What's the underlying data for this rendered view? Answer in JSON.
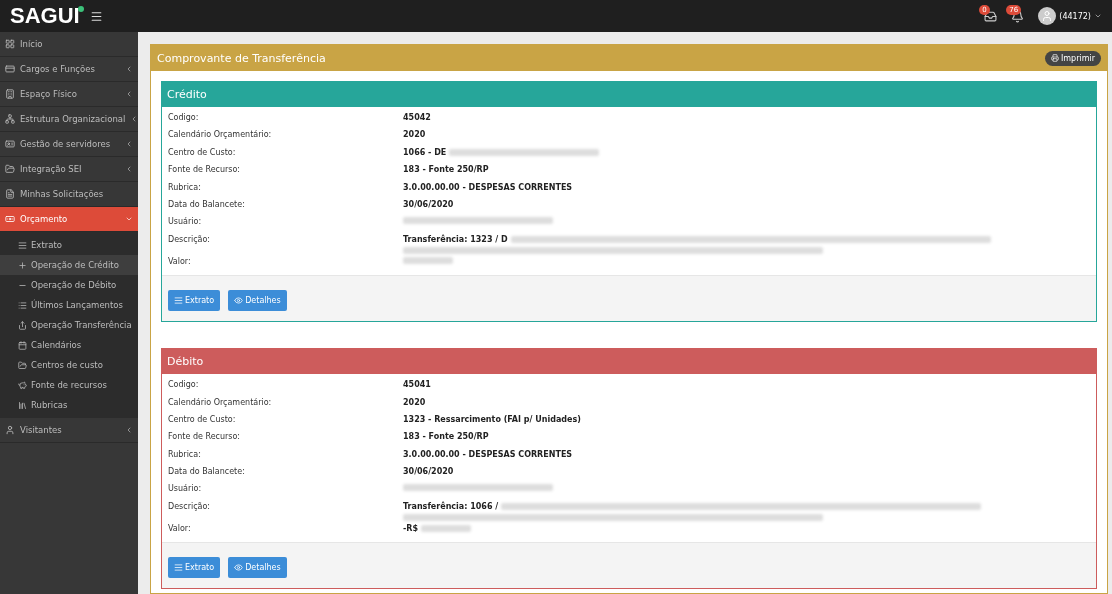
{
  "topbar": {
    "logo": "SAGUI",
    "notifications": [
      {
        "kind": "tasks",
        "count": "0"
      },
      {
        "kind": "bell",
        "count": "76"
      }
    ],
    "user": "(44172)"
  },
  "sidebar": {
    "items": [
      {
        "label": "Início",
        "selected": false
      },
      {
        "label": "Cargos e Funções",
        "expanded": false,
        "selected": false
      },
      {
        "label": "Espaço Físico",
        "expanded": false,
        "selected": false
      },
      {
        "label": "Estrutura Organizacional",
        "expanded": false,
        "selected": false
      },
      {
        "label": "Gestão de servidores",
        "expanded": false,
        "selected": false
      },
      {
        "label": "Integração SEI",
        "expanded": false,
        "selected": false
      },
      {
        "label": "Minhas Solicitações",
        "selected": false
      },
      {
        "label": "Orçamento",
        "expanded": true,
        "selected": true,
        "children": [
          {
            "label": "Extrato",
            "selected": false
          },
          {
            "label": "Operação de Crédito",
            "selected": true
          },
          {
            "label": "Operação de Débito",
            "selected": false
          },
          {
            "label": "Últimos Lançamentos",
            "selected": false
          },
          {
            "label": "Operação Transferência",
            "selected": false
          },
          {
            "label": "Calendários",
            "selected": false
          },
          {
            "label": "Centros de custo",
            "selected": false
          },
          {
            "label": "Fonte de recursos",
            "selected": false
          },
          {
            "label": "Rubricas",
            "selected": false
          }
        ]
      },
      {
        "label": "Visitantes",
        "expanded": false,
        "selected": false
      }
    ]
  },
  "main": {
    "title": "Comprovante de Transferência",
    "print_button": "Imprimir",
    "panels": [
      {
        "kind": "credit",
        "title": "Crédito",
        "rows": [
          {
            "label": "Codigo:",
            "value": "45042"
          },
          {
            "label": "Calendário Orçamentário:",
            "value": "2020"
          },
          {
            "label": "Centro de Custo:",
            "value": "1066 - DE"
          },
          {
            "label": "Fonte de Recurso:",
            "value": "183 - Fonte 250/RP"
          },
          {
            "label": "Rubrica:",
            "value": "3.0.00.00.00 - DESPESAS CORRENTES"
          },
          {
            "label": "Data do Balancete:",
            "value": "30/06/2020"
          },
          {
            "label": "Usuário:"
          },
          {
            "label": "Descrição:",
            "value": "Transferência: 1323 / D"
          },
          {
            "label": "Valor:"
          }
        ],
        "buttons": [
          "Extrato",
          "Detalhes"
        ]
      },
      {
        "kind": "debit",
        "title": "Débito",
        "rows": [
          {
            "label": "Codigo:",
            "value": "45041"
          },
          {
            "label": "Calendário Orçamentário:",
            "value": "2020"
          },
          {
            "label": "Centro de Custo:",
            "value": "1323 - Ressarcimento (FAI p/ Unidades)"
          },
          {
            "label": "Fonte de Recurso:",
            "value": "183 - Fonte 250/RP"
          },
          {
            "label": "Rubrica:",
            "value": "3.0.00.00.00 - DESPESAS CORRENTES"
          },
          {
            "label": "Data do Balancete:",
            "value": "30/06/2020"
          },
          {
            "label": "Usuário:"
          },
          {
            "label": "Descrição:",
            "value": "Transferência: 1066 /"
          },
          {
            "label": "Valor:",
            "value": "-R$"
          }
        ],
        "buttons": [
          "Extrato",
          "Detalhes"
        ]
      }
    ]
  }
}
